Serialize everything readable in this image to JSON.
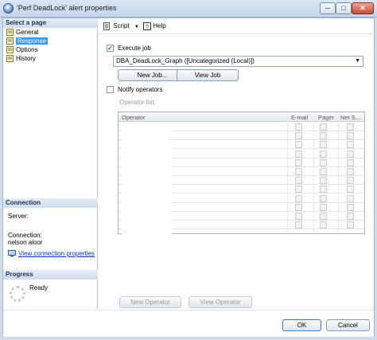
{
  "window": {
    "title": "'Perf DeadLock' alert properties",
    "minimize": "─",
    "maximize": "□",
    "close": "✕"
  },
  "left": {
    "select_page_header": "Select a page",
    "pages": [
      {
        "label": "General",
        "icon": "page-icon"
      },
      {
        "label": "Response",
        "icon": "page-icon",
        "selected": true
      },
      {
        "label": "Options",
        "icon": "page-icon"
      },
      {
        "label": "History",
        "icon": "page-icon"
      }
    ],
    "connection_header": "Connection",
    "server_label": "Server:",
    "connection_label": "Connection:",
    "connection_value": "nelson aloor",
    "view_connection_link": "View connection properties",
    "progress_header": "Progress",
    "progress_status": "Ready"
  },
  "toolbar": {
    "script_label": "Script",
    "help_label": "Help"
  },
  "response": {
    "execute_job_label": "Execute job",
    "execute_job_checked": true,
    "job_selected": "DBA_DeadLock_Graph ([Uncategorized (Local)])",
    "new_job_button": "New Job...",
    "view_job_button": "View Job",
    "notify_operators_label": "Notify operators",
    "notify_operators_checked": false,
    "operator_list_label": "Operator list:",
    "columns": [
      "Operator",
      "E-mail",
      "Pager",
      "Net S..."
    ],
    "row_count": 12,
    "new_operator_button": "New Operator",
    "view_operator_button": "View Operator"
  },
  "footer": {
    "ok_button": "OK",
    "cancel_button": "Cancel"
  }
}
